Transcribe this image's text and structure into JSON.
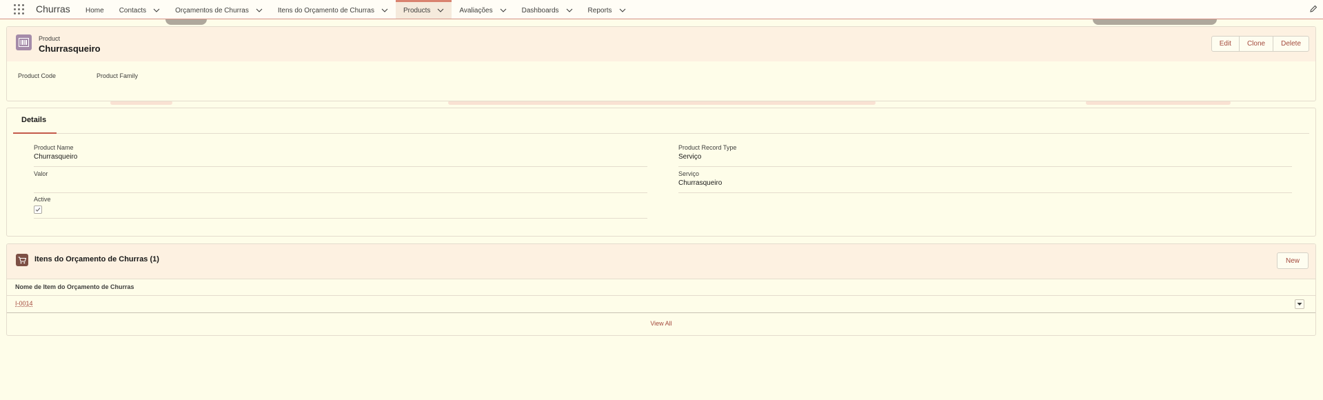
{
  "app": {
    "name": "Churras"
  },
  "nav": {
    "items": [
      {
        "label": "Home",
        "has_menu": false
      },
      {
        "label": "Contacts",
        "has_menu": true
      },
      {
        "label": "Orçamentos de Churras",
        "has_menu": true
      },
      {
        "label": "Itens do Orçamento de Churras",
        "has_menu": true
      },
      {
        "label": "Products",
        "has_menu": true,
        "active": true
      },
      {
        "label": "Avaliações",
        "has_menu": true
      },
      {
        "label": "Dashboards",
        "has_menu": true
      },
      {
        "label": "Reports",
        "has_menu": true
      }
    ]
  },
  "record": {
    "object_label": "Product",
    "title": "Churrasqueiro",
    "actions": {
      "edit": "Edit",
      "clone": "Clone",
      "delete": "Delete"
    },
    "highlights": {
      "product_code": "Product Code",
      "product_family": "Product Family"
    }
  },
  "details": {
    "tab_label": "Details",
    "product_name_label": "Product Name",
    "product_name_value": "Churrasqueiro",
    "valor_label": "Valor",
    "active_label": "Active",
    "active_checked": true,
    "record_type_label": "Product Record Type",
    "record_type_value": "Serviço",
    "servico_label": "Serviço",
    "servico_value": "Churrasqueiro"
  },
  "related": {
    "title": "Itens do Orçamento de Churras (1)",
    "new_label": "New",
    "column_header": "Nome de Item do Orçamento de Churras",
    "rows": [
      {
        "name": "I-0014"
      }
    ],
    "view_all": "View All"
  },
  "colors": {
    "accent": "#c45a4a",
    "link": "#a3493c",
    "product_icon": "#a58ba9",
    "cart_icon": "#7d4f44",
    "page_bg": "#fefde9"
  }
}
